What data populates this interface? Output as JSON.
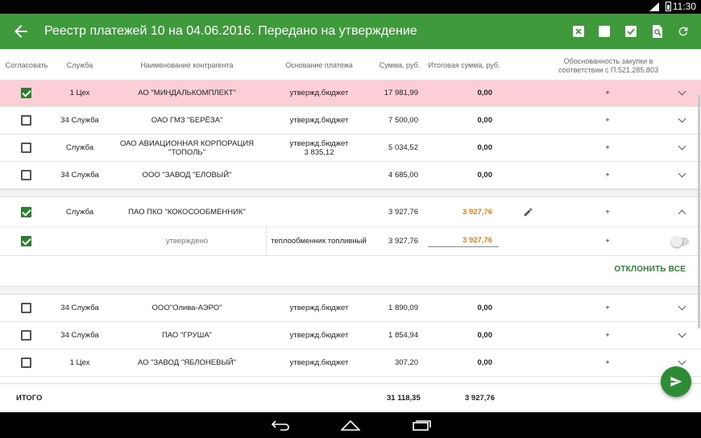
{
  "status": {
    "time": "11:30"
  },
  "appbar": {
    "title": "Реестр платежей 10 на 04.06.2016. Передано на утверждение"
  },
  "columns": {
    "agree": "Согласовать",
    "service": "Служба",
    "counterparty": "Наименование контрагента",
    "basis": "Основание платежа",
    "sum": "Сумма, руб.",
    "total_sum": "Итоговая сумма, руб.",
    "justification": "Обоснованность закупки в соответствии с П.521.285.803"
  },
  "rows": [
    {
      "checked": true,
      "service": "1 Цех",
      "counterparty": "АО \"МИНДАЛЬКОМПЛЕКТ\"",
      "basis": "утвержд.бюджет",
      "sum": "17 981,99",
      "total": "0,00",
      "just": "+"
    },
    {
      "checked": false,
      "service": "34 Служба",
      "counterparty": "ОАО ГМЗ \"БЕРЁЗА\"",
      "basis": "утвержд.бюджет",
      "sum": "7 500,00",
      "total": "0,00",
      "just": "+"
    },
    {
      "checked": false,
      "service": "Служба",
      "counterparty": "ОАО АВИАЦИОННАЯ КОРПОРАЦИЯ \"ТОПОЛЬ\"",
      "basis": "утвержд.бюджет\n3 835,12",
      "sum": "5 034,52",
      "total": "0,00",
      "just": "+"
    },
    {
      "checked": false,
      "service": "34 Служба",
      "counterparty": "ООО \"ЗАВОД \"ЕЛОВЫЙ\"",
      "basis": "",
      "sum": "4 685,00",
      "total": "0,00",
      "just": "+"
    }
  ],
  "expanded": {
    "checked": true,
    "service": "Служба",
    "counterparty": "ПАО ПКО \"КОКОСООБМЕННИК\"",
    "sum": "3 927,76",
    "total": "3 927,76",
    "just": "+",
    "sub": {
      "checked": true,
      "status": "утверждено",
      "basis": "теплообменник топливный",
      "sum": "3 927,76",
      "total": "3 927,76",
      "just": "+"
    },
    "reject_label": "ОТКЛОНИТЬ ВСЕ"
  },
  "rows2": [
    {
      "checked": false,
      "service": "34 Служба",
      "counterparty": "ООО\"Олива-АЭРО\"",
      "basis": "утвержд.бюджет",
      "sum": "1 890,09",
      "total": "0,00",
      "just": "+"
    },
    {
      "checked": false,
      "service": "34 Служба",
      "counterparty": "ПАО \"ГРУША\"",
      "basis": "утвержд.бюджет",
      "sum": "1 854,94",
      "total": "0,00",
      "just": "+"
    },
    {
      "checked": false,
      "service": "1 Цех",
      "counterparty": "АО \"ЗАВОД \"ЯБЛОНЕВЫЙ\"",
      "basis": "утвержд.бюджет",
      "sum": "307,20",
      "total": "0,00",
      "just": "+"
    }
  ],
  "total": {
    "label": "ИТОГО",
    "sum": "31 118,35",
    "total": "3 927,76"
  },
  "colors": {
    "appbar": "#3f9a3c",
    "accent": "#2e7d32",
    "highlight_row": "#fccfd6",
    "orange": "#e67e22"
  }
}
